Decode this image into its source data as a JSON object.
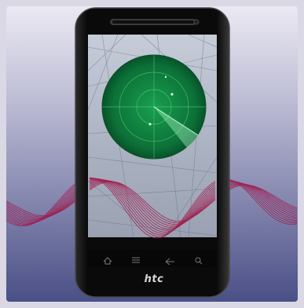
{
  "phone": {
    "brand": "htc",
    "nav_keys": [
      "home-icon",
      "menu-icon",
      "back-icon",
      "search-icon"
    ]
  },
  "radar": {
    "blips": 3
  },
  "colors": {
    "frame_bg": "#d9d8e4",
    "panel_top": "#e6e4ee",
    "panel_bottom": "#4a4f86",
    "phone_body": "#101010",
    "screen_map": "#b3b9c6",
    "radar_green": "#0f7a3c",
    "wave": "#a21347"
  }
}
